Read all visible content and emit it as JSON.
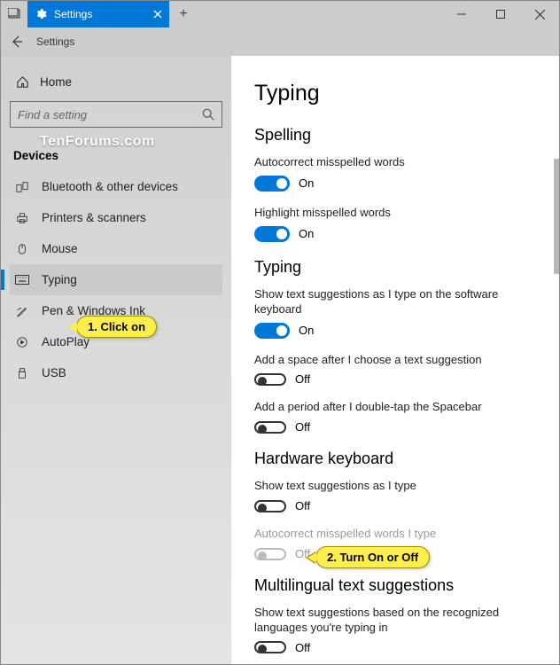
{
  "titlebar": {
    "tab_title": "Settings",
    "new_tab": "+"
  },
  "secondary": {
    "label": "Settings"
  },
  "watermark": "TenForums.com",
  "sidebar": {
    "home": "Home",
    "search_placeholder": "Find a setting",
    "section": "Devices",
    "items": [
      {
        "label": "Bluetooth & other devices"
      },
      {
        "label": "Printers & scanners"
      },
      {
        "label": "Mouse"
      },
      {
        "label": "Typing"
      },
      {
        "label": "Pen & Windows Ink"
      },
      {
        "label": "AutoPlay"
      },
      {
        "label": "USB"
      }
    ]
  },
  "main": {
    "page_title": "Typing",
    "groups": [
      {
        "heading": "Spelling",
        "settings": [
          {
            "label": "Autocorrect misspelled words",
            "state": "On"
          },
          {
            "label": "Highlight misspelled words",
            "state": "On"
          }
        ]
      },
      {
        "heading": "Typing",
        "settings": [
          {
            "label": "Show text suggestions as I type on the software keyboard",
            "state": "On"
          },
          {
            "label": "Add a space after I choose a text suggestion",
            "state": "Off"
          },
          {
            "label": "Add a period after I double-tap the Spacebar",
            "state": "Off"
          }
        ]
      },
      {
        "heading": "Hardware keyboard",
        "settings": [
          {
            "label": "Show text suggestions as I type",
            "state": "Off"
          },
          {
            "label": "Autocorrect misspelled words I type",
            "state": "Off"
          }
        ]
      },
      {
        "heading": "Multilingual text suggestions",
        "settings": [
          {
            "label": "Show text suggestions based on the recognized languages you're typing in",
            "state": "Off"
          }
        ]
      }
    ]
  },
  "callouts": {
    "c1": "1. Click on",
    "c2": "2. Turn On or Off"
  }
}
